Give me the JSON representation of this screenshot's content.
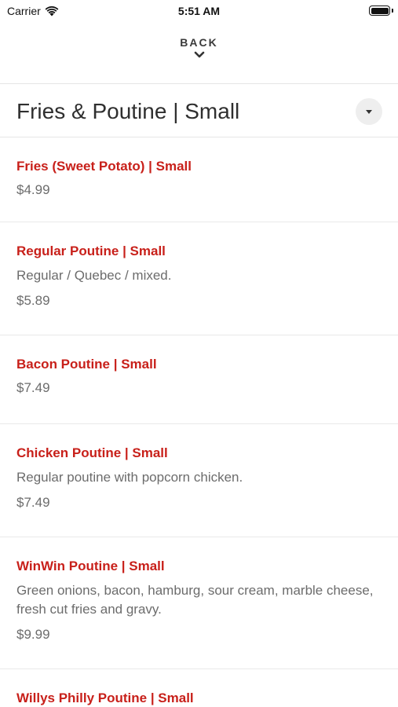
{
  "status_bar": {
    "carrier": "Carrier",
    "time": "5:51 AM"
  },
  "nav": {
    "back_label": "BACK"
  },
  "category": {
    "title": "Fries & Poutine | Small"
  },
  "menu_items": [
    {
      "name": "Fries (Sweet Potato) | Small",
      "description": "",
      "price": "$4.99"
    },
    {
      "name": "Regular Poutine | Small",
      "description": "Regular / Quebec / mixed.",
      "price": "$5.89"
    },
    {
      "name": "Bacon Poutine | Small",
      "description": "",
      "price": "$7.49"
    },
    {
      "name": "Chicken Poutine | Small",
      "description": "Regular poutine with popcorn chicken.",
      "price": "$7.49"
    },
    {
      "name": "WinWin Poutine | Small",
      "description": "Green onions, bacon, hamburg, sour cream, marble cheese, fresh cut fries and gravy.",
      "price": "$9.99"
    },
    {
      "name": "Willys Philly Poutine | Small",
      "description": "",
      "price": ""
    }
  ],
  "colors": {
    "item_name": "#c8201a",
    "secondary_text": "#6c6c6c",
    "title_text": "#2f2f2f"
  },
  "icons": {
    "wifi": "wifi-icon",
    "battery": "battery-icon",
    "back": "chevron-down-icon",
    "dropdown": "caret-down-icon"
  }
}
